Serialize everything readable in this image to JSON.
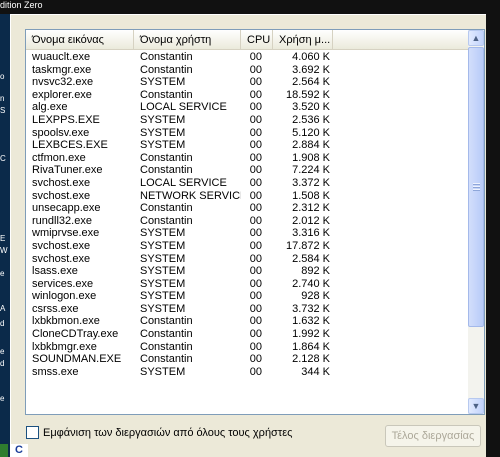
{
  "desktop": {
    "top_text": "dition Zero",
    "left_glyphs": [
      "o",
      "n",
      "S",
      "C",
      "E",
      "W",
      "e",
      "A",
      "d",
      "e",
      "d",
      "e"
    ]
  },
  "columns": [
    "Όνομα εικόνας",
    "Όνομα χρήστη",
    "CPU",
    "Χρήση μ..."
  ],
  "processes": [
    {
      "image": "wuauclt.exe",
      "user": "Constantin",
      "cpu": "00",
      "mem": "4.060 K"
    },
    {
      "image": "taskmgr.exe",
      "user": "Constantin",
      "cpu": "00",
      "mem": "3.692 K"
    },
    {
      "image": "nvsvc32.exe",
      "user": "SYSTEM",
      "cpu": "00",
      "mem": "2.564 K"
    },
    {
      "image": "explorer.exe",
      "user": "Constantin",
      "cpu": "00",
      "mem": "18.592 K"
    },
    {
      "image": "alg.exe",
      "user": "LOCAL SERVICE",
      "cpu": "00",
      "mem": "3.520 K"
    },
    {
      "image": "LEXPPS.EXE",
      "user": "SYSTEM",
      "cpu": "00",
      "mem": "2.536 K"
    },
    {
      "image": "spoolsv.exe",
      "user": "SYSTEM",
      "cpu": "00",
      "mem": "5.120 K"
    },
    {
      "image": "LEXBCES.EXE",
      "user": "SYSTEM",
      "cpu": "00",
      "mem": "2.884 K"
    },
    {
      "image": "ctfmon.exe",
      "user": "Constantin",
      "cpu": "00",
      "mem": "1.908 K"
    },
    {
      "image": "RivaTuner.exe",
      "user": "Constantin",
      "cpu": "00",
      "mem": "7.224 K"
    },
    {
      "image": "svchost.exe",
      "user": "LOCAL SERVICE",
      "cpu": "00",
      "mem": "3.372 K"
    },
    {
      "image": "svchost.exe",
      "user": "NETWORK SERVICE",
      "cpu": "00",
      "mem": "1.508 K"
    },
    {
      "image": "unsecapp.exe",
      "user": "Constantin",
      "cpu": "00",
      "mem": "2.312 K"
    },
    {
      "image": "rundll32.exe",
      "user": "Constantin",
      "cpu": "00",
      "mem": "2.012 K"
    },
    {
      "image": "wmiprvse.exe",
      "user": "SYSTEM",
      "cpu": "00",
      "mem": "3.316 K"
    },
    {
      "image": "svchost.exe",
      "user": "SYSTEM",
      "cpu": "00",
      "mem": "17.872 K"
    },
    {
      "image": "svchost.exe",
      "user": "SYSTEM",
      "cpu": "00",
      "mem": "2.584 K"
    },
    {
      "image": "lsass.exe",
      "user": "SYSTEM",
      "cpu": "00",
      "mem": "892 K"
    },
    {
      "image": "services.exe",
      "user": "SYSTEM",
      "cpu": "00",
      "mem": "2.740 K"
    },
    {
      "image": "winlogon.exe",
      "user": "SYSTEM",
      "cpu": "00",
      "mem": "928 K"
    },
    {
      "image": "csrss.exe",
      "user": "SYSTEM",
      "cpu": "00",
      "mem": "3.732 K"
    },
    {
      "image": "lxbkbmon.exe",
      "user": "Constantin",
      "cpu": "00",
      "mem": "1.632 K"
    },
    {
      "image": "CloneCDTray.exe",
      "user": "Constantin",
      "cpu": "00",
      "mem": "1.992 K"
    },
    {
      "image": "lxbkbmgr.exe",
      "user": "Constantin",
      "cpu": "00",
      "mem": "1.864 K"
    },
    {
      "image": "SOUNDMAN.EXE",
      "user": "Constantin",
      "cpu": "00",
      "mem": "2.128 K"
    },
    {
      "image": "smss.exe",
      "user": "SYSTEM",
      "cpu": "00",
      "mem": "344 K"
    }
  ],
  "show_all_label": "Εμφάνιση των διεργασιών από όλους τους χρήστες",
  "end_process_label": "Τέλος διεργασίας",
  "taskbar_glyph": "C"
}
